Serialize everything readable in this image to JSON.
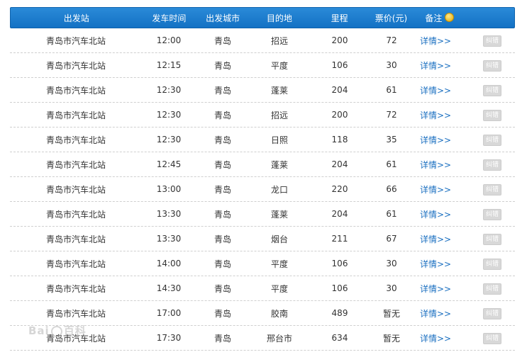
{
  "table": {
    "headers": {
      "station": "出发站",
      "time": "发车时间",
      "city": "出发城市",
      "destination": "目的地",
      "distance": "里程",
      "price": "票价(元)",
      "note": "备注"
    },
    "rows": [
      {
        "station": "青岛市汽车北站",
        "time": "12:00",
        "city": "青岛",
        "destination": "招远",
        "distance": "200",
        "price": "72",
        "detail": "详情>>",
        "report": "纠错"
      },
      {
        "station": "青岛市汽车北站",
        "time": "12:15",
        "city": "青岛",
        "destination": "平度",
        "distance": "106",
        "price": "30",
        "detail": "详情>>",
        "report": "纠错"
      },
      {
        "station": "青岛市汽车北站",
        "time": "12:30",
        "city": "青岛",
        "destination": "蓬莱",
        "distance": "204",
        "price": "61",
        "detail": "详情>>",
        "report": "纠错"
      },
      {
        "station": "青岛市汽车北站",
        "time": "12:30",
        "city": "青岛",
        "destination": "招远",
        "distance": "200",
        "price": "72",
        "detail": "详情>>",
        "report": "纠错"
      },
      {
        "station": "青岛市汽车北站",
        "time": "12:30",
        "city": "青岛",
        "destination": "日照",
        "distance": "118",
        "price": "35",
        "detail": "详情>>",
        "report": "纠错"
      },
      {
        "station": "青岛市汽车北站",
        "time": "12:45",
        "city": "青岛",
        "destination": "蓬莱",
        "distance": "204",
        "price": "61",
        "detail": "详情>>",
        "report": "纠错"
      },
      {
        "station": "青岛市汽车北站",
        "time": "13:00",
        "city": "青岛",
        "destination": "龙口",
        "distance": "220",
        "price": "66",
        "detail": "详情>>",
        "report": "纠错"
      },
      {
        "station": "青岛市汽车北站",
        "time": "13:30",
        "city": "青岛",
        "destination": "蓬莱",
        "distance": "204",
        "price": "61",
        "detail": "详情>>",
        "report": "纠错"
      },
      {
        "station": "青岛市汽车北站",
        "time": "13:30",
        "city": "青岛",
        "destination": "烟台",
        "distance": "211",
        "price": "67",
        "detail": "详情>>",
        "report": "纠错"
      },
      {
        "station": "青岛市汽车北站",
        "time": "14:00",
        "city": "青岛",
        "destination": "平度",
        "distance": "106",
        "price": "30",
        "detail": "详情>>",
        "report": "纠错"
      },
      {
        "station": "青岛市汽车北站",
        "time": "14:30",
        "city": "青岛",
        "destination": "平度",
        "distance": "106",
        "price": "30",
        "detail": "详情>>",
        "report": "纠错"
      },
      {
        "station": "青岛市汽车北站",
        "time": "17:00",
        "city": "青岛",
        "destination": "胶南",
        "distance": "489",
        "price": "暂无",
        "detail": "详情>>",
        "report": "纠错"
      },
      {
        "station": "青岛市汽车北站",
        "time": "17:30",
        "city": "青岛",
        "destination": "邢台市",
        "distance": "634",
        "price": "暂无",
        "detail": "详情>>",
        "report": "纠错"
      }
    ]
  },
  "colors": {
    "header_bg": "#1b7ccd",
    "link": "#1a6fc0",
    "report_button": "#d8d8d8"
  },
  "icons": {
    "note": "coin-icon"
  },
  "watermark": "Bai 百科"
}
